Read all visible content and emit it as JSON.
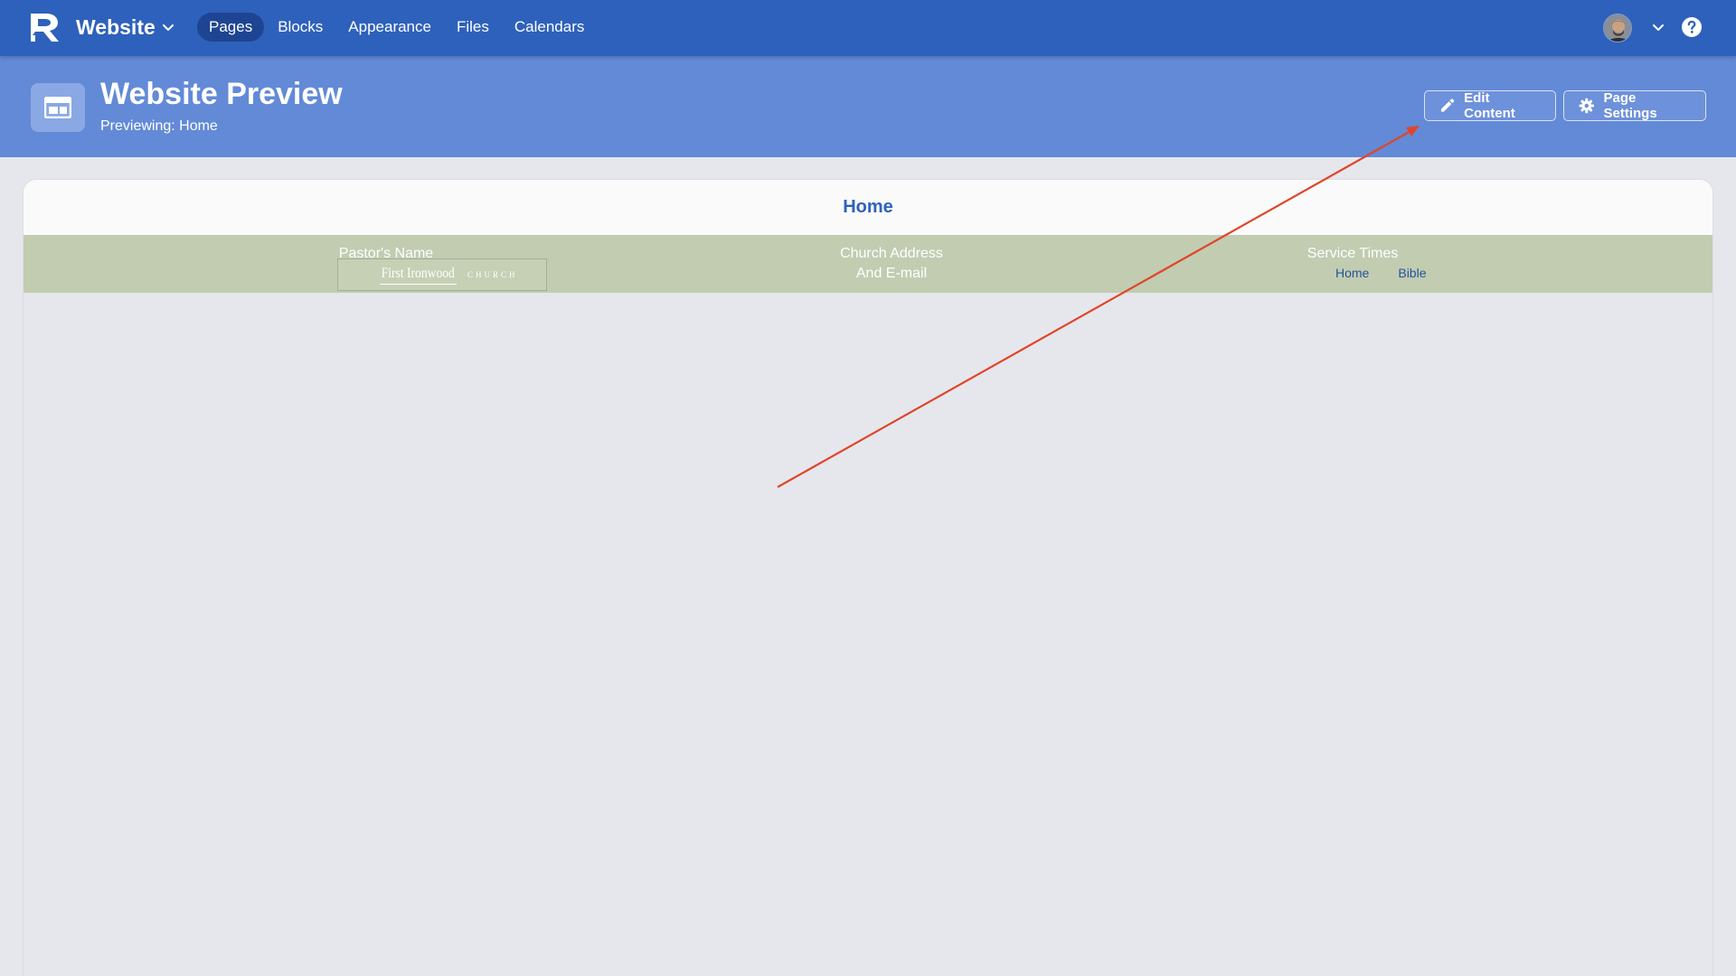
{
  "app": {
    "name": "Website",
    "logo_icon": "r-logo-icon",
    "brand_color": "#2e61bb"
  },
  "nav": {
    "items": [
      {
        "label": "Pages",
        "active": true
      },
      {
        "label": "Blocks",
        "active": false
      },
      {
        "label": "Appearance",
        "active": false
      },
      {
        "label": "Files",
        "active": false
      },
      {
        "label": "Calendars",
        "active": false
      }
    ]
  },
  "user": {
    "avatar_icon": "user-avatar",
    "menu_icon": "chevron-down-icon",
    "help_icon": "help-icon"
  },
  "header": {
    "title": "Website Preview",
    "subtitle": "Previewing: Home",
    "icon": "website-layout-icon",
    "background_color": "#638ad7",
    "buttons": {
      "edit_label": "Edit Content",
      "settings_label": "Page Settings"
    }
  },
  "preview": {
    "title": "Home",
    "site_header": {
      "pastor_name": "Pastor's Name",
      "church_address": "Church Address",
      "church_email": "And E-mail",
      "service_times": "Service Times",
      "logo_name": "First Ironwood",
      "logo_suffix": "CHURCH",
      "links": [
        "Home",
        "Bible"
      ],
      "background_color": "#c2ccb1"
    }
  },
  "annotation": {
    "type": "arrow",
    "color": "#e0452a",
    "target": "edit-content-button"
  }
}
